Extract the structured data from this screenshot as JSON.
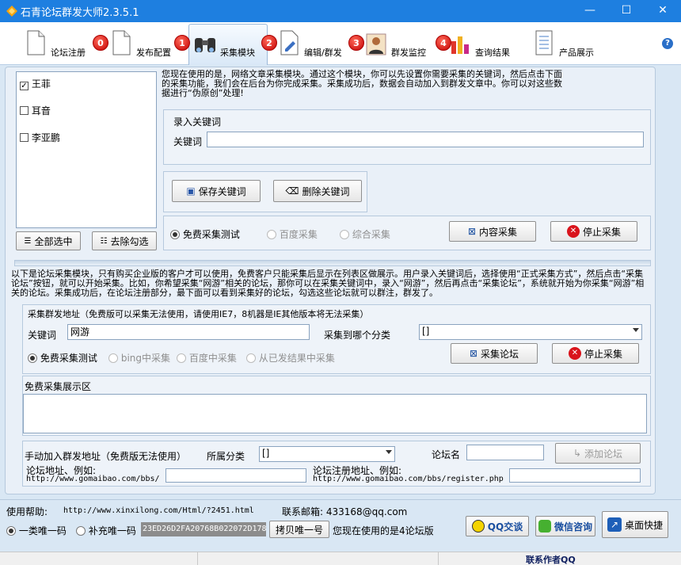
{
  "window": {
    "title": "石青论坛群发大师2.3.5.1"
  },
  "toolbar": {
    "items": [
      {
        "label": "论坛注册",
        "badge": "0"
      },
      {
        "label": "发布配置",
        "badge": "1"
      },
      {
        "label": "采集模块",
        "badge": "2"
      },
      {
        "label": "编辑/群发",
        "badge": "3"
      },
      {
        "label": "群发监控",
        "badge": "4"
      },
      {
        "label": "查询结果"
      },
      {
        "label": "产品展示"
      }
    ],
    "help_glyph": "?"
  },
  "keyword_list": {
    "items": [
      {
        "label": "王菲",
        "checked": true
      },
      {
        "label": "耳音",
        "checked": false
      },
      {
        "label": "李亚鹏",
        "checked": false
      }
    ],
    "select_all_label": "全部选中",
    "unselect_label": "去除勾选"
  },
  "intro_text": "您现在使用的是，网络文章采集模块。通过这个模块，你可以先设置你需要采集的关键词，然后点击下面的采集功能，我们会在后台为你完成采集。采集成功后，数据会自动加入到群发文章中。你可以对这些数据进行“伪原创”处理!",
  "keyword_entry": {
    "group_title": "录入关键词",
    "keyword_label": "关键词",
    "keyword_value": "",
    "save_label": "保存关键词",
    "delete_label": "删除关键词"
  },
  "article_collect": {
    "options": [
      {
        "label": "免费采集测试",
        "selected": true,
        "enabled": true
      },
      {
        "label": "百度采集",
        "selected": false,
        "enabled": false
      },
      {
        "label": "综合采集",
        "selected": false,
        "enabled": false
      }
    ],
    "collect_label": "内容采集",
    "stop_label": "停止采集"
  },
  "forum_intro_text": "以下是论坛采集模块，只有购买企业版的客户才可以使用，免费客户只能采集后显示在列表区做展示。用户录入关键词后，选择使用“正式采集方式”，然后点击“采集论坛”按钮，就可以开始采集。比如，你希望采集“网游”相关的论坛，那你可以在采集关键词中，录入“网游”，然后再点击“采集论坛”，系统就开始为你采集“网游”相关的论坛。采集成功后，在论坛注册部分，最下面可以看到采集好的论坛，勾选这些论坛就可以群注，群发了。",
  "forum_collect": {
    "group_title": "采集群发地址（免费版可以采集无法使用，请使用IE7，8机器是IE其他版本将无法采集）",
    "keyword_label": "关键词",
    "keyword_value": "网游",
    "category_label": "采集到哪个分类",
    "category_value": "[]",
    "options": [
      {
        "label": "免费采集测试",
        "selected": true,
        "enabled": true
      },
      {
        "label": "bing中采集",
        "selected": false,
        "enabled": false
      },
      {
        "label": "百度中采集",
        "selected": false,
        "enabled": false
      },
      {
        "label": "从已发结果中采集",
        "selected": false,
        "enabled": false
      }
    ],
    "collect_label": "采集论坛",
    "stop_label": "停止采集",
    "display_title": "免费采集展示区"
  },
  "manual_add": {
    "title": "手动加入群发地址（免费版无法使用）",
    "category_label": "所属分类",
    "category_value": "[]",
    "forum_name_label": "论坛名",
    "add_label": "添加论坛",
    "forum_url_label": "论坛地址、例如:",
    "forum_url_example": "http://www.gomaibao.com/bbs/",
    "register_url_label": "论坛注册地址、例如:",
    "register_url_example": "http://www.gomaibao.com/bbs/register.php"
  },
  "footer": {
    "help_label": "使用帮助:",
    "help_url": "http://www.xinxilong.com/Html/?2451.html",
    "email_label": "联系邮箱: 433168@qq.com",
    "radio1": "一类唯一码",
    "radio2": "补充唯一码",
    "code": "23ED26D2FA20768B022072D178",
    "copy_label": "拷贝唯一号",
    "version_text": "您现在使用的是4论坛版",
    "qq_label": "QQ交谈",
    "wechat_label": "微信咨询",
    "desktop_label": "桌面快捷"
  },
  "status": {
    "contact": "联系作者QQ"
  },
  "colors": {
    "titlebar": "#1e7fe0",
    "panel": "#d9e7f4",
    "badge": "#d40000"
  }
}
